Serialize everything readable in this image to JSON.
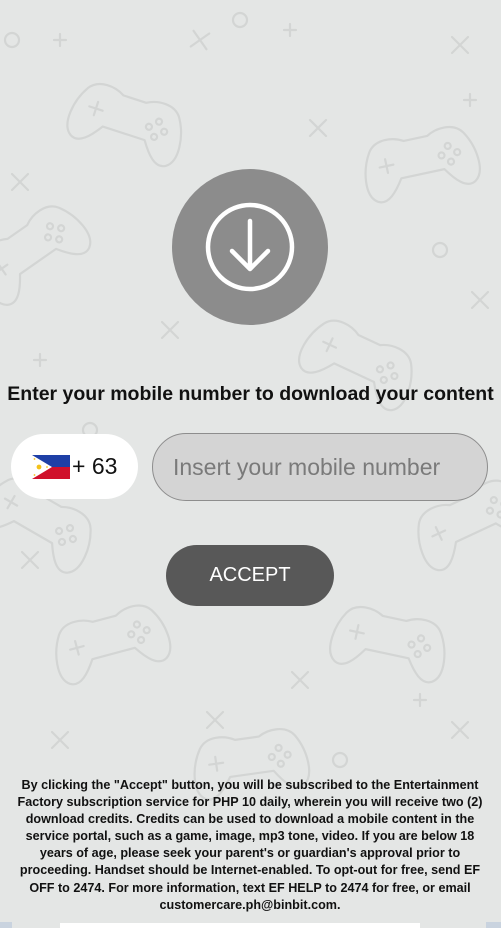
{
  "icons": {
    "download": "download-arrow-icon",
    "flag": "philippines-flag-icon",
    "pattern": "game-controller-icon"
  },
  "colors": {
    "background": "#e4e6e5",
    "download_circle": "#8c8c8c",
    "accept_button": "#585858",
    "input_fill": "#d4d4d4"
  },
  "headline": "Enter your mobile number to download your content",
  "phone": {
    "country_code": "+ 63",
    "placeholder": "Insert your mobile number",
    "value": ""
  },
  "accept_label": "ACCEPT",
  "disclaimer": "By clicking the \"Accept\" button, you will be subscribed to the Entertainment Factory subscription service for PHP 10 daily, wherein you will receive two (2) download credits. Credits can be used to download a mobile content in the service portal, such as a game, image, mp3 tone, video. If you are below 18 years of age, please seek your parent's or guardian's approval prior to proceeding. Handset should be Internet-enabled. To opt-out for free, send EF OFF to 2474. For more information, text EF HELP to 2474 for free, or email customercare.ph@binbit.com."
}
